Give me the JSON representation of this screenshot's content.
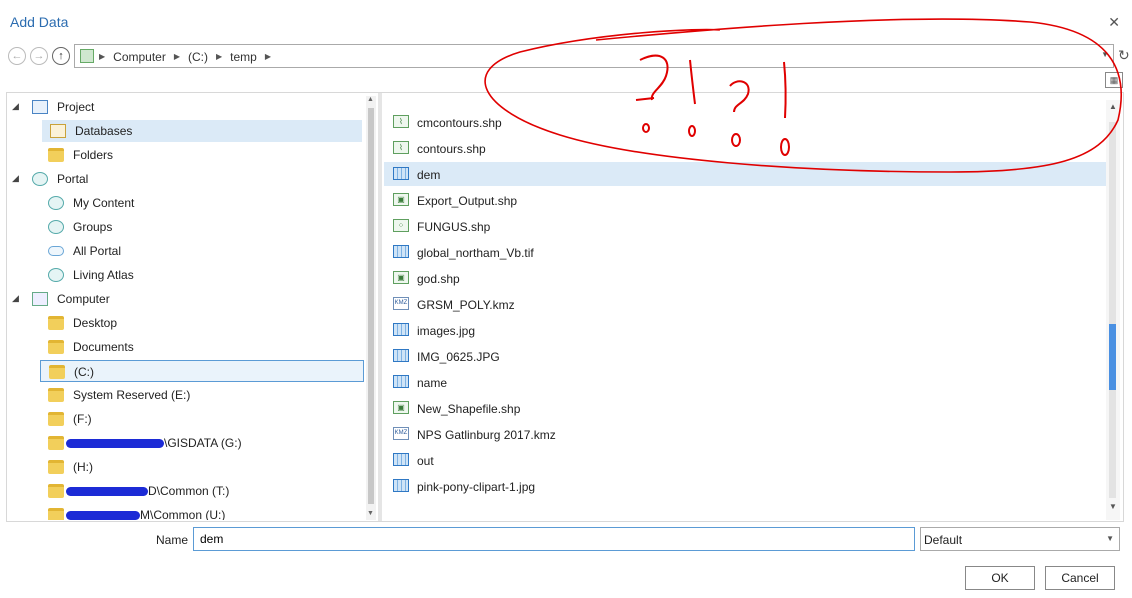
{
  "window": {
    "title": "Add Data",
    "close_glyph": "✕"
  },
  "address": {
    "crumbs": [
      "Computer",
      "(C:)",
      "temp"
    ]
  },
  "tree": {
    "items": [
      {
        "label": "Project",
        "kind": "proj",
        "level": 0,
        "expanded": true
      },
      {
        "label": "Databases",
        "kind": "db",
        "level": 1,
        "selected": true
      },
      {
        "label": "Folders",
        "kind": "folder",
        "level": 1
      },
      {
        "label": "Portal",
        "kind": "globe",
        "level": 0,
        "expanded": true
      },
      {
        "label": "My Content",
        "kind": "globe",
        "level": 1
      },
      {
        "label": "Groups",
        "kind": "globe",
        "level": 1
      },
      {
        "label": "All Portal",
        "kind": "cloud",
        "level": 1
      },
      {
        "label": "Living Atlas",
        "kind": "globe",
        "level": 1
      },
      {
        "label": "Computer",
        "kind": "pc",
        "level": 0,
        "expanded": true
      },
      {
        "label": "Desktop",
        "kind": "folder",
        "level": 1
      },
      {
        "label": "Documents",
        "kind": "folder",
        "level": 1
      },
      {
        "label": "(C:)",
        "kind": "folder",
        "level": 1,
        "current": true
      },
      {
        "label": "System Reserved (E:)",
        "kind": "folder",
        "level": 1
      },
      {
        "label": "(F:)",
        "kind": "folder",
        "level": 1
      },
      {
        "label": "\\GISDATA (G:)",
        "kind": "folder",
        "level": 1,
        "redacted": true
      },
      {
        "label": "(H:)",
        "kind": "folder",
        "level": 1
      },
      {
        "label": "D\\Common (T:)",
        "kind": "folder",
        "level": 1,
        "redacted": true
      },
      {
        "label": "M\\Common (U:)",
        "kind": "folder",
        "level": 1,
        "redacted": true
      }
    ]
  },
  "files": [
    {
      "name": "cmcontours.shp",
      "type": "line"
    },
    {
      "name": "contours.shp",
      "type": "line"
    },
    {
      "name": "dem",
      "type": "raster",
      "selected": true
    },
    {
      "name": "Export_Output.shp",
      "type": "poly"
    },
    {
      "name": "FUNGUS.shp",
      "type": "point"
    },
    {
      "name": "global_northam_Vb.tif",
      "type": "raster"
    },
    {
      "name": "god.shp",
      "type": "poly"
    },
    {
      "name": "GRSM_POLY.kmz",
      "type": "kmz"
    },
    {
      "name": "images.jpg",
      "type": "raster"
    },
    {
      "name": "IMG_0625.JPG",
      "type": "raster"
    },
    {
      "name": "name",
      "type": "raster"
    },
    {
      "name": "New_Shapefile.shp",
      "type": "poly"
    },
    {
      "name": "NPS Gatlinburg 2017.kmz",
      "type": "kmz"
    },
    {
      "name": "out",
      "type": "raster"
    },
    {
      "name": "pink-pony-clipart-1.jpg",
      "type": "raster"
    }
  ],
  "footer": {
    "name_label": "Name",
    "name_value": "dem",
    "filter_value": "Default",
    "ok_label": "OK",
    "cancel_label": "Cancel"
  },
  "annotation": {
    "text": "?!?!",
    "color": "#e00000"
  }
}
